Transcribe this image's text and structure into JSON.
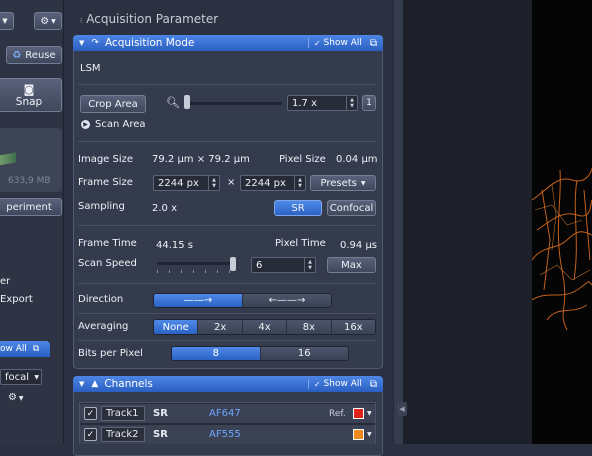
{
  "left": {
    "reuse_label": "Reuse",
    "snap_label": "Snap",
    "storage": "633,9 MB",
    "experiment_label": "periment",
    "item_er": "er",
    "item_export": "Export",
    "show_all": "ow All",
    "confocal_value": "focal"
  },
  "title": "Acquisition Parameter",
  "acq": {
    "header": "Acquisition Mode",
    "show_all": "Show All",
    "mode": "LSM",
    "crop_area": "Crop Area",
    "zoom_value": "1.7 x",
    "zoom_reset": "1",
    "scan_area": "Scan Area",
    "image_size_label": "Image Size",
    "image_size_value": "79.2 µm × 79.2 µm",
    "pixel_size_label": "Pixel Size",
    "pixel_size_value": "0.04 µm",
    "frame_size_label": "Frame Size",
    "frame_x": "2244 px",
    "times": "×",
    "frame_y": "2244 px",
    "presets": "Presets",
    "sampling_label": "Sampling",
    "sampling_value": "2.0 x",
    "sr_label": "SR",
    "confocal_label": "Confocal",
    "frame_time_label": "Frame Time",
    "frame_time_value": "44.15 s",
    "pixel_time_label": "Pixel Time",
    "pixel_time_value": "0.94 µs",
    "scan_speed_label": "Scan Speed",
    "scan_speed_value": "6",
    "max_label": "Max",
    "direction_label": "Direction",
    "averaging_label": "Averaging",
    "averaging_options": [
      "None",
      "2x",
      "4x",
      "8x",
      "16x"
    ],
    "averaging_selected": "None",
    "bits_label": "Bits per Pixel",
    "bits_options": [
      "8",
      "16"
    ],
    "bits_selected": "8"
  },
  "channels": {
    "header": "Channels",
    "show_all": "Show All",
    "tracks": [
      {
        "name": "Track1",
        "mode": "SR",
        "dye": "AF647",
        "ref": "Ref.",
        "color": "#e0241b"
      },
      {
        "name": "Track2",
        "mode": "SR",
        "dye": "AF555",
        "ref": "",
        "color": "#f08a1c"
      }
    ]
  }
}
